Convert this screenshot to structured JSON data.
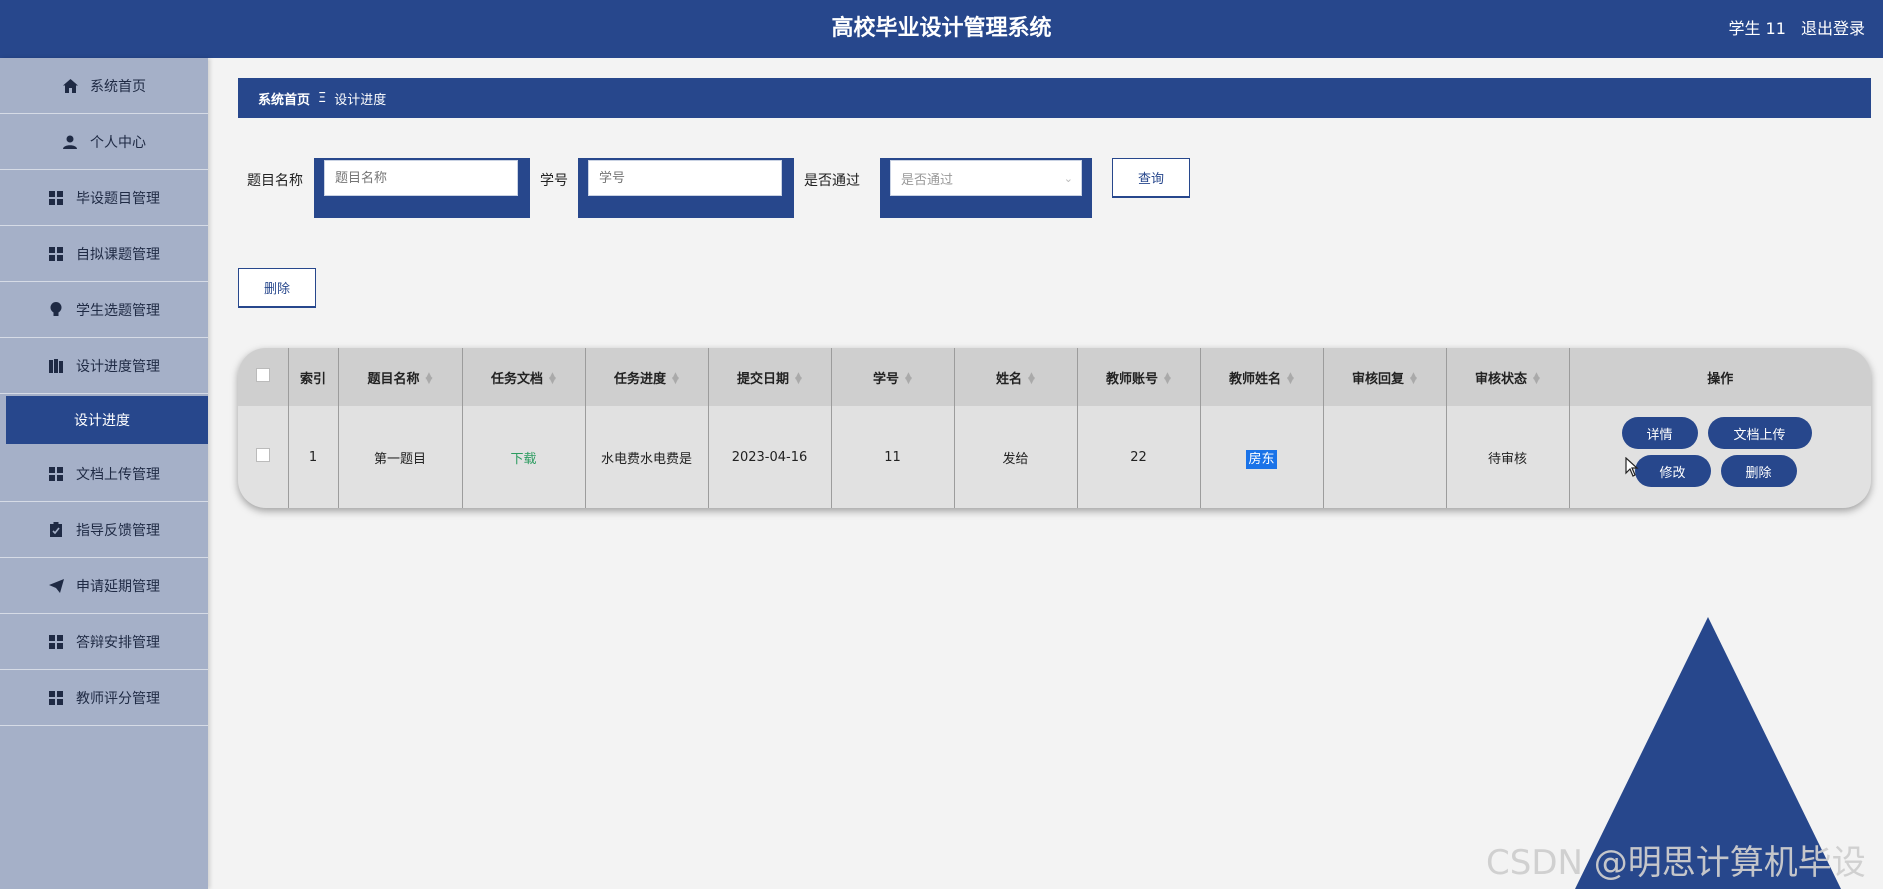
{
  "header": {
    "title": "高校毕业设计管理系统",
    "user": "学生 11",
    "logout": "退出登录"
  },
  "sidebar": {
    "items": [
      {
        "label": "系统首页",
        "icon": "home-icon"
      },
      {
        "label": "个人中心",
        "icon": "person-icon"
      },
      {
        "label": "毕设题目管理",
        "icon": "grid-icon"
      },
      {
        "label": "自拟课题管理",
        "icon": "grid-icon"
      },
      {
        "label": "学生选题管理",
        "icon": "bulb-icon"
      },
      {
        "label": "设计进度管理",
        "icon": "book-icon"
      },
      {
        "label": "文档上传管理",
        "icon": "grid-icon"
      },
      {
        "label": "指导反馈管理",
        "icon": "clipboard-icon"
      },
      {
        "label": "申请延期管理",
        "icon": "send-icon"
      },
      {
        "label": "答辩安排管理",
        "icon": "grid-icon"
      },
      {
        "label": "教师评分管理",
        "icon": "grid-icon"
      }
    ],
    "active_sub": "设计进度"
  },
  "breadcrumb": {
    "home": "系统首页",
    "separator": "Ξ",
    "current": "设计进度"
  },
  "search": {
    "topic_label": "题目名称",
    "topic_placeholder": "题目名称",
    "id_label": "学号",
    "id_placeholder": "学号",
    "pass_label": "是否通过",
    "pass_placeholder": "是否通过",
    "query_button": "查询"
  },
  "delete_button": "删除",
  "table": {
    "headers": [
      "索引",
      "题目名称",
      "任务文档",
      "任务进度",
      "提交日期",
      "学号",
      "姓名",
      "教师账号",
      "教师姓名",
      "审核回复",
      "审核状态",
      "操作"
    ],
    "rows": [
      {
        "index": "1",
        "topic": "第一题目",
        "doc": "下载",
        "progress": "水电费水电费是",
        "date": "2023-04-16",
        "student_id": "11",
        "name": "发给",
        "teacher_account": "22",
        "teacher_name": "房东",
        "reply": "",
        "status": "待审核"
      }
    ],
    "ops": {
      "detail": "详情",
      "upload": "文档上传",
      "edit": "修改",
      "delete": "删除"
    }
  },
  "colors": {
    "primary": "#27478c",
    "sidebar": "#a5b0c8",
    "download": "#2b9b5f"
  },
  "watermark": "CSDN @明思计算机毕设"
}
